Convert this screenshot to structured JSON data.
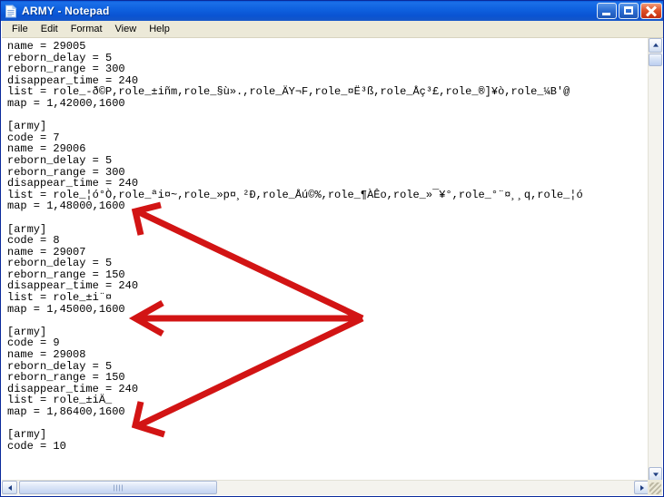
{
  "window": {
    "title": "ARMY - Notepad",
    "icon": "notepad-document-icon",
    "controls": {
      "minimize": "Minimize",
      "maximize": "Maximize",
      "close": "Close"
    }
  },
  "menu": {
    "items": [
      {
        "label": "File"
      },
      {
        "label": "Edit"
      },
      {
        "label": "Format"
      },
      {
        "label": "View"
      },
      {
        "label": "Help"
      }
    ]
  },
  "document": {
    "lines": [
      "name = 29005",
      "reborn_delay = 5",
      "reborn_range = 300",
      "disappear_time = 240",
      "list = role_-ð©P,role_±iñm,role_§ù».,role_ÄY¬F,role_¤Ë³ß,role_Åç³£,role_®]¥ò,role_¼B'@",
      "map = 1,42000,1600",
      "",
      "[army]",
      "code = 7",
      "name = 29006",
      "reborn_delay = 5",
      "reborn_range = 300",
      "disappear_time = 240",
      "list = role_¦ó°Ò,role_ªi¤~,role_»p¤¸²Ð,role_Åú©%,role_¶ÀÊo,role_»¯¥°,role_°¨¤¸¸q,role_¦ó",
      "map = 1,48000,1600",
      "",
      "[army]",
      "code = 8",
      "name = 29007",
      "reborn_delay = 5",
      "reborn_range = 150",
      "disappear_time = 240",
      "list = role_±i¨¤",
      "map = 1,45000,1600",
      "",
      "[army]",
      "code = 9",
      "name = 29008",
      "reborn_delay = 5",
      "reborn_range = 150",
      "disappear_time = 240",
      "list = role_±iÄ_",
      "map = 1,86400,1600",
      "",
      "[army]",
      "code = 10"
    ]
  },
  "annotations": {
    "color": "#d21414",
    "arrows": [
      {
        "name": "arrow-to-map-48000",
        "target_line": "map = 1,48000,1600"
      },
      {
        "name": "arrow-to-map-45000",
        "target_line": "map = 1,45000,1600"
      },
      {
        "name": "arrow-to-map-86400",
        "target_line": "map = 1,86400,1600"
      }
    ]
  },
  "scrollbars": {
    "vertical": {
      "up": "Scroll up",
      "down": "Scroll down",
      "thumb": "Vertical scroll thumb"
    },
    "horizontal": {
      "left": "Scroll left",
      "right": "Scroll right",
      "thumb": "Horizontal scroll thumb"
    }
  }
}
